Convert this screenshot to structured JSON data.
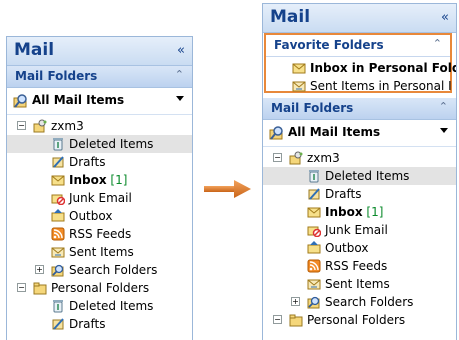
{
  "left": {
    "title": "Mail",
    "collapse_glyph": "«",
    "section_label": "Mail Folders",
    "section_chevron": "⌃",
    "view_label": "All Mail Items",
    "tree": [
      {
        "label": "zxm3",
        "level": 0,
        "toggle": "−",
        "icon": "account-icon"
      },
      {
        "label": "Deleted Items",
        "level": 1,
        "icon": "deleted-items-icon",
        "selected": true
      },
      {
        "label": "Drafts",
        "level": 1,
        "icon": "drafts-icon"
      },
      {
        "label": "Inbox",
        "count": "[1]",
        "level": 1,
        "icon": "inbox-icon",
        "bold": true
      },
      {
        "label": "Junk Email",
        "level": 1,
        "icon": "junk-email-icon"
      },
      {
        "label": "Outbox",
        "level": 1,
        "icon": "outbox-icon"
      },
      {
        "label": "RSS Feeds",
        "level": 1,
        "icon": "rss-feeds-icon"
      },
      {
        "label": "Sent Items",
        "level": 1,
        "icon": "sent-items-icon"
      },
      {
        "label": "Search Folders",
        "level": 1,
        "toggle": "+",
        "icon": "search-folders-icon"
      },
      {
        "label": "Personal Folders",
        "level": 0,
        "toggle": "−",
        "icon": "personal-folders-icon"
      },
      {
        "label": "Deleted Items",
        "level": 1,
        "icon": "deleted-items-icon"
      },
      {
        "label": "Drafts",
        "level": 1,
        "icon": "drafts-icon"
      }
    ]
  },
  "right": {
    "title": "Mail",
    "collapse_glyph": "«",
    "favorites_label": "Favorite Folders",
    "favorites_chevron": "⌃",
    "favorites": [
      {
        "label": "Inbox in Personal Folde",
        "icon": "inbox-icon",
        "bold": true
      },
      {
        "label": "Sent Items in Personal I",
        "icon": "sent-items-icon"
      }
    ],
    "section_label": "Mail Folders",
    "section_chevron": "⌃",
    "view_label": "All Mail Items",
    "tree": [
      {
        "label": "zxm3",
        "level": 0,
        "toggle": "−",
        "icon": "account-icon"
      },
      {
        "label": "Deleted Items",
        "level": 1,
        "icon": "deleted-items-icon",
        "selected": true
      },
      {
        "label": "Drafts",
        "level": 1,
        "icon": "drafts-icon"
      },
      {
        "label": "Inbox",
        "count": "[1]",
        "level": 1,
        "icon": "inbox-icon",
        "bold": true
      },
      {
        "label": "Junk Email",
        "level": 1,
        "icon": "junk-email-icon"
      },
      {
        "label": "Outbox",
        "level": 1,
        "icon": "outbox-icon"
      },
      {
        "label": "RSS Feeds",
        "level": 1,
        "icon": "rss-feeds-icon"
      },
      {
        "label": "Sent Items",
        "level": 1,
        "icon": "sent-items-icon"
      },
      {
        "label": "Search Folders",
        "level": 1,
        "toggle": "+",
        "icon": "search-folders-icon"
      },
      {
        "label": "Personal Folders",
        "level": 0,
        "toggle": "−",
        "icon": "personal-folders-icon"
      }
    ]
  },
  "colors": {
    "accent": "#15428b",
    "highlight_border": "#e8883a",
    "arrow": "#e07d2e",
    "count_green": "#0a8a2b"
  }
}
